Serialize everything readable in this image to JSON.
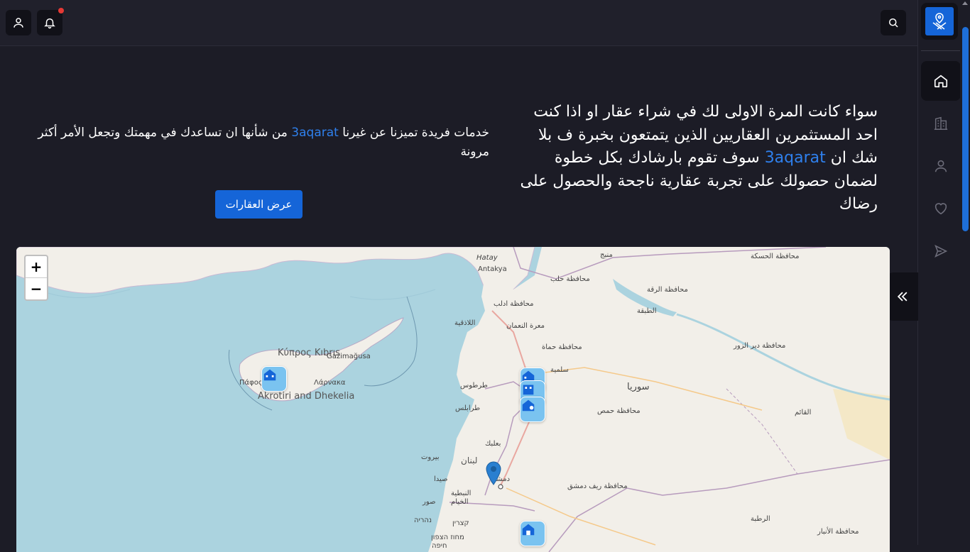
{
  "topbar": {
    "icons": [
      "user-icon",
      "bell-icon",
      "search-icon"
    ],
    "has_notification": true
  },
  "sidebar": {
    "logo": "logo-icon",
    "items": [
      {
        "icon": "home-icon",
        "active": true
      },
      {
        "icon": "building-icon",
        "active": false
      },
      {
        "icon": "user-icon",
        "active": false
      },
      {
        "icon": "heart-icon",
        "active": false
      },
      {
        "icon": "send-icon",
        "active": false
      }
    ],
    "collapse_icon": "double-chevron-left-icon"
  },
  "hero": {
    "right_before": "سواء كانت المرة الاولى لك في شراء عقار او اذا كنت احد المستثمرين العقاريين الذين يتمتعون بخبرة ف بلا شك ان ",
    "right_brand": "3aqarat",
    "right_after": " سوف تقوم بارشادك بكل خطوة لضمان حصولك على تجربة عقارية ناجحة والحصول على رضاك",
    "left_before": "خدمات فريدة تميزنا عن غيرنا ",
    "left_brand": "3aqarat",
    "left_after": " من شأنها ان تساعدك في مهمتك وتجعل الأمر أكثر مرونة",
    "cta_label": "عرض العقارات"
  },
  "colors": {
    "accent": "#1565d8",
    "brand_text": "#2f80ed",
    "background": "#1c1c26",
    "sea": "#abd3df",
    "land": "#f2efe9",
    "marker": "#7ac3f0"
  },
  "map": {
    "zoom_in": "+",
    "zoom_out": "−",
    "labels": {
      "hatay": "Hatay",
      "antakya": "Antakya",
      "manbij": "منبج",
      "hasakah": "محافظة الحسكة",
      "aleppo_gov": "محافظة حلب",
      "raqqa_gov": "محافظة الرقة",
      "idlib_gov": "محافظة ادلب",
      "tabqa": "الطبقة",
      "latakia": "اللاذقية",
      "maarat": "معرة النعمان",
      "hama_gov": "محافظة حماة",
      "deir_gov": "محافظة دير الزور",
      "cyprus": "Κύπρος Kıbrıs",
      "gazimagusa": "Gazimağusa",
      "pafos": "Πάφος",
      "larnaka": "Λάρνακα",
      "akrotiri": "Akrotiri and Dhekelia",
      "salamiyah": "سلمية",
      "tartus": "طرطوس",
      "syria": "سوريا",
      "tripoli": "طرابلس",
      "homs_gov": "محافظة حمص",
      "qaim": "القائم",
      "baalbek": "بعلبك",
      "beirut": "بيروت",
      "lebanon": "لبنان",
      "damascus": "دمشق",
      "rif_dimashq": "محافظة ريف دمشق",
      "saida": "صيدا",
      "nabatieh": "النبطية",
      "khiam": "الخيام",
      "sour": "صور",
      "nahariya": "נהריה",
      "katsrin": "קצרין",
      "rutba": "الرطبة",
      "anbar": "محافظة الأنبار",
      "haifa": "חיפה",
      "north_district": "מחוז הצפון"
    },
    "markers": [
      "building-marker-icon",
      "building-marker-icon",
      "building-marker-icon",
      "building-marker-icon",
      "building-marker-icon"
    ],
    "pin": "location-pin-icon"
  }
}
